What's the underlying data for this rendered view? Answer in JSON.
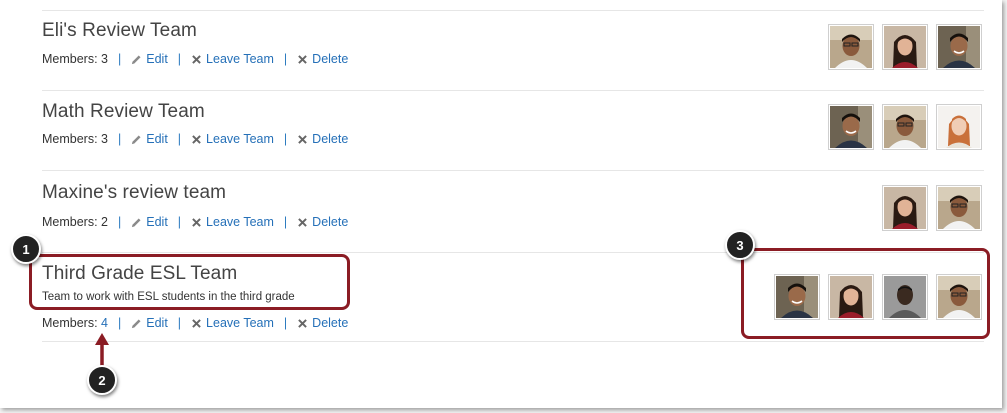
{
  "teams": [
    {
      "name": "Eli's Review Team",
      "description": "",
      "members_label": "Members: 3",
      "members_prefix": "Members: ",
      "members_count": "3",
      "avatars": [
        "man-glasses",
        "woman-hair",
        "man-smile"
      ]
    },
    {
      "name": "Math Review Team",
      "description": "",
      "members_label": "Members: 3",
      "members_prefix": "Members: ",
      "members_count": "3",
      "avatars": [
        "man-smile",
        "man-glasses",
        "woman-red"
      ]
    },
    {
      "name": "Maxine's review team",
      "description": "",
      "members_label": "Members: 2",
      "members_prefix": "Members: ",
      "members_count": "2",
      "avatars": [
        "woman-hair",
        "man-glasses"
      ]
    },
    {
      "name": "Third Grade ESL Team",
      "description": "Team to work with ESL students in the third grade",
      "members_label": "Members: 4",
      "members_prefix": "Members: ",
      "members_count": "4",
      "avatars": [
        "man-smile",
        "woman-hair",
        "man-dark",
        "man-glasses"
      ]
    }
  ],
  "actions": {
    "edit": "Edit",
    "leave": "Leave Team",
    "delete": "Delete",
    "separator": "|"
  },
  "icons": {
    "edit": "pencil-icon",
    "leave": "x-icon",
    "delete": "x-icon"
  },
  "callouts": [
    "1",
    "2",
    "3"
  ],
  "colors": {
    "link": "#2570b8",
    "callout": "#8b1c24",
    "badge": "#222222"
  }
}
